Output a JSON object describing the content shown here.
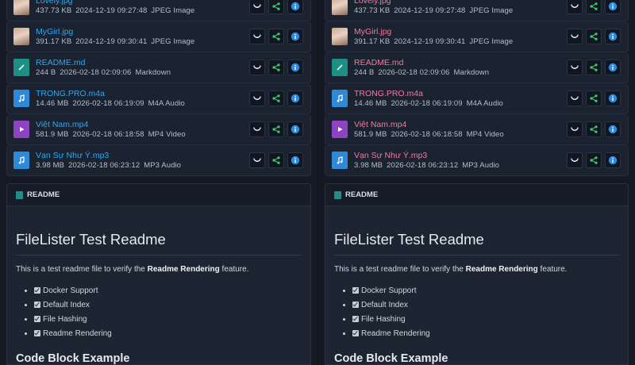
{
  "files": [
    {
      "name": "Lovely.jpg",
      "size": "437.73 KB",
      "date": "2024-12-19 09:27:48",
      "type": "JPEG Image",
      "kind": "image"
    },
    {
      "name": "MyGirl.jpg",
      "size": "391.17 KB",
      "date": "2024-12-19 09:30:41",
      "type": "JPEG Image",
      "kind": "image"
    },
    {
      "name": "README.md",
      "size": "244 B",
      "date": "2026-02-18 02:09:06",
      "type": "Markdown",
      "kind": "markdown"
    },
    {
      "name": "TRONG.PRO.m4a",
      "size": "14.46 MB",
      "date": "2026-02-18 06:19:09",
      "type": "M4A Audio",
      "kind": "audio"
    },
    {
      "name": "Việt Nam.mp4",
      "size": "581.9 MB",
      "date": "2026-02-18 06:18:58",
      "type": "MP4 Video",
      "kind": "video"
    },
    {
      "name": "Vạn Sự Như Ý.mp3",
      "size": "3.98 MB",
      "date": "2026-02-18 06:23:12",
      "type": "MP3 Audio",
      "kind": "audio"
    }
  ],
  "actions": {
    "preview_icon": "eye-icon",
    "share_icon": "share-icon",
    "info_icon": "info-icon"
  },
  "readme": {
    "header": "README",
    "title": "FileLister Test Readme",
    "para_prefix": "This is a test readme file to verify the ",
    "para_bold": "Readme Rendering",
    "para_suffix": " feature.",
    "checklist": [
      "Docker Support",
      "Default Index",
      "File Hashing",
      "Readme Rendering"
    ],
    "subheading": "Code Block Example"
  },
  "colors": {
    "left_name": "#32a6ef",
    "right_name": "#f07aa0",
    "background": "#141923"
  }
}
